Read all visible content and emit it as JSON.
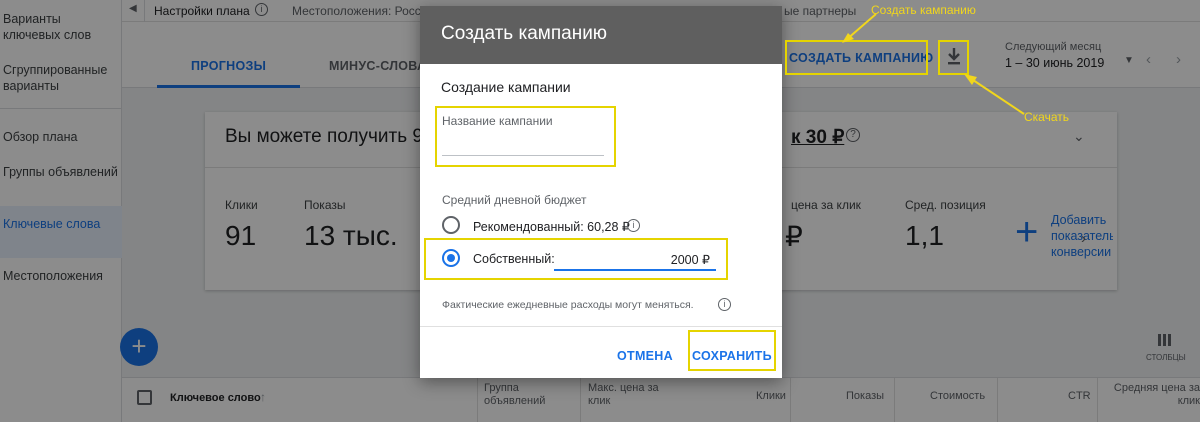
{
  "sidebar": {
    "items": [
      {
        "label": "Варианты ключевых слов"
      },
      {
        "label": "Сгруппированные варианты"
      },
      {
        "label": "Обзор плана"
      },
      {
        "label": "Группы объявлений"
      },
      {
        "label": "Ключевые слова"
      },
      {
        "label": "Местоположения"
      }
    ]
  },
  "topbar": {
    "plan_settings": "Настройки плана",
    "locations": "Местоположения: Росс",
    "partners": "ые партнеры"
  },
  "tabs": {
    "forecasts": "ПРОГНОЗЫ",
    "negative": "МИНУС-СЛОВА"
  },
  "header": {
    "create_campaign": "СОЗДАТЬ КАМПАНИЮ",
    "date_caption": "Следующий месяц",
    "date_range": "1 – 30 июнь 2019"
  },
  "summary": {
    "left": "Вы можете получить 9",
    "right": "к 30 ₽"
  },
  "metrics": {
    "clicks_label": "Клики",
    "clicks_value": "91",
    "impr_label": "Показы",
    "impr_value": "13 тыс.",
    "cpc_label": "цена за клик",
    "cpc_value": "₽",
    "pos_label": "Сред. позиция",
    "pos_value": "1,1",
    "add_text": "Добавить показатель конверсии"
  },
  "columns_label": "СТОЛБЦЫ",
  "table": {
    "keyword": "Ключевое слово",
    "group": "Группа объявлений",
    "max_cpc": "Макс. цена за клик",
    "clicks": "Клики",
    "impressions": "Показы",
    "cost": "Стоимость",
    "ctr": "CTR",
    "avg_cpc": "Средняя цена за клик"
  },
  "dialog": {
    "title": "Создать кампанию",
    "section": "Создание кампании",
    "name_label": "Название кампании",
    "name_value": "",
    "budget_label": "Средний дневной бюджет",
    "recommended": "Рекомендованный: 60,28 ₽",
    "own": "Собственный:",
    "own_value": "2000 ₽",
    "note": "Фактические ежедневные расходы могут меняться.",
    "cancel": "ОТМЕНА",
    "save": "СОХРАНИТЬ"
  },
  "annotations": {
    "create": "Создать кампанию",
    "download": "Скачать"
  },
  "colors": {
    "accent": "#1a73e8",
    "highlight": "#e5d400"
  }
}
